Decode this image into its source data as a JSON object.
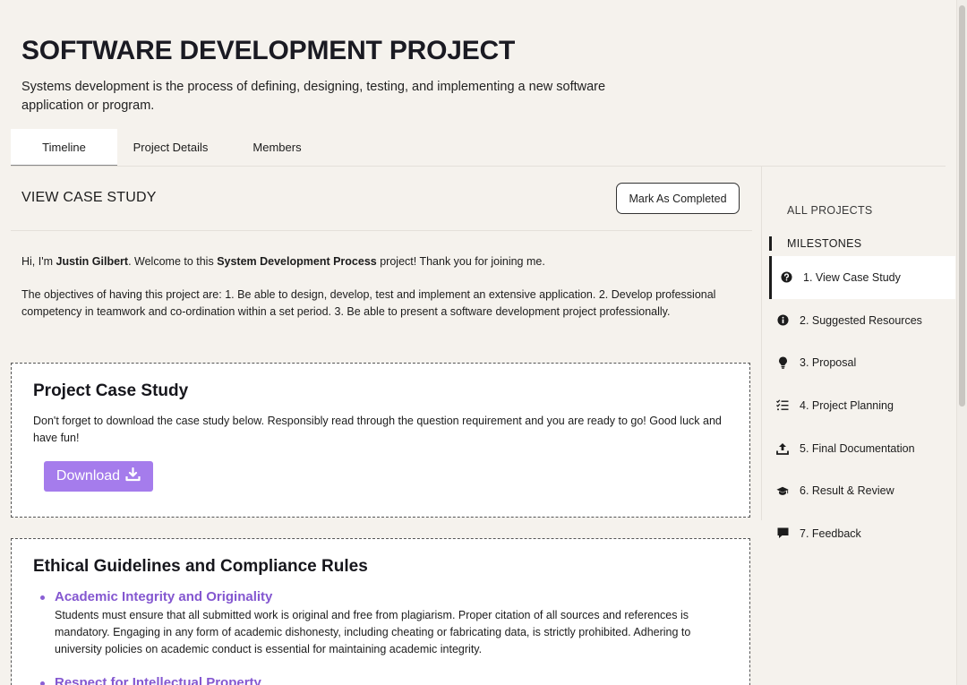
{
  "header": {
    "title": "SOFTWARE DEVELOPMENT PROJECT",
    "subtitle": "Systems development is the process of defining, designing, testing, and implementing a new software application or program."
  },
  "tabs": [
    {
      "label": "Timeline",
      "active": true
    },
    {
      "label": "Project Details",
      "active": false
    },
    {
      "label": "Members",
      "active": false
    }
  ],
  "main": {
    "section_title": "VIEW CASE STUDY",
    "complete_button": "Mark As Completed",
    "intro": {
      "greeting_pre": "Hi, I'm ",
      "author": "Justin Gilbert",
      "greeting_mid": ". Welcome to this ",
      "project_name": "System Development Process",
      "greeting_post": " project! Thank you for joining me.",
      "objectives": "The objectives of having this project are: 1. Be able to design, develop, test and implement an extensive application. 2. Develop professional competency in teamwork and co-ordination within a set period. 3. Be able to present a software development project professionally."
    },
    "case_card": {
      "title": "Project Case Study",
      "text": "Don't forget to download the case study below. Responsibly read through the question requirement and you are ready to go! Good luck and have fun!",
      "download_label": "Download",
      "download_icon": "download-icon"
    },
    "ethics_card": {
      "title": "Ethical Guidelines and Compliance Rules",
      "rules": [
        {
          "title": "Academic Integrity and Originality",
          "text": "Students must ensure that all submitted work is original and free from plagiarism. Proper citation of all sources and references is mandatory. Engaging in any form of academic dishonesty, including cheating or fabricating data, is strictly prohibited. Adhering to university policies on academic conduct is essential for maintaining academic integrity."
        },
        {
          "title": "Respect for Intellectual Property",
          "text": ""
        }
      ]
    }
  },
  "sidebar": {
    "all_projects": "ALL PROJECTS",
    "milestones_label": "MILESTONES",
    "milestones": [
      {
        "label": "1. View Case Study",
        "icon": "question-circle-icon",
        "active": true
      },
      {
        "label": "2. Suggested Resources",
        "icon": "info-circle-icon",
        "active": false
      },
      {
        "label": "3. Proposal",
        "icon": "lightbulb-icon",
        "active": false
      },
      {
        "label": "4. Project Planning",
        "icon": "checklist-icon",
        "active": false
      },
      {
        "label": "5. Final Documentation",
        "icon": "upload-icon",
        "active": false
      },
      {
        "label": "6. Result & Review",
        "icon": "graduation-cap-icon",
        "active": false
      },
      {
        "label": "7. Feedback",
        "icon": "comment-icon",
        "active": false
      }
    ]
  },
  "colors": {
    "background": "#f5f2ed",
    "accent": "#a57cec",
    "link": "#8457d0"
  }
}
